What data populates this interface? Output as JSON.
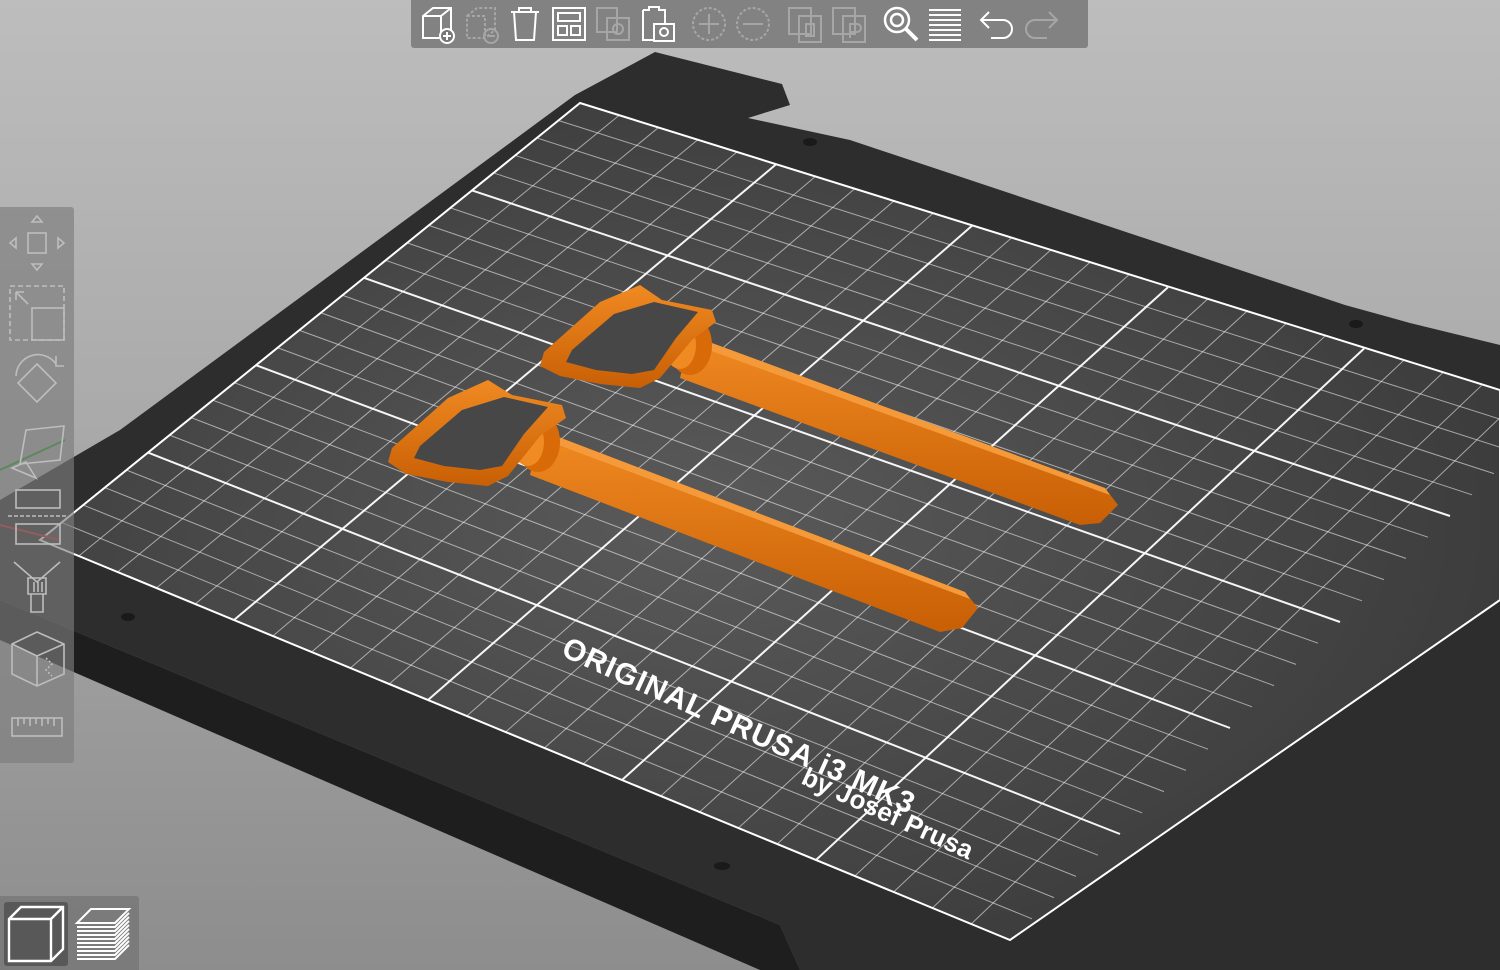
{
  "toolbar": {
    "buttons": [
      {
        "name": "add-button",
        "icon": "add-cube-icon",
        "enabled": true
      },
      {
        "name": "delete-button",
        "icon": "delete-icon",
        "enabled": false
      },
      {
        "name": "delete-all-button",
        "icon": "trash-icon",
        "enabled": true
      },
      {
        "name": "arrange-button",
        "icon": "arrange-icon",
        "enabled": true
      },
      {
        "name": "copy-button",
        "icon": "copy-icon",
        "enabled": false
      },
      {
        "name": "paste-button",
        "icon": "paste-icon",
        "enabled": true
      },
      {
        "name": "add-instance-button",
        "icon": "plus-circle-icon",
        "enabled": false
      },
      {
        "name": "remove-instance-button",
        "icon": "minus-circle-icon",
        "enabled": false
      },
      {
        "name": "split-objects-button",
        "icon": "split-objects-icon",
        "enabled": false
      },
      {
        "name": "split-parts-button",
        "icon": "split-parts-icon",
        "enabled": false
      },
      {
        "name": "search-button",
        "icon": "search-icon",
        "enabled": true
      },
      {
        "name": "layers-editing-button",
        "icon": "layers-icon",
        "enabled": true
      },
      {
        "name": "undo-button",
        "icon": "undo-icon",
        "enabled": true
      },
      {
        "name": "redo-button",
        "icon": "redo-icon",
        "enabled": false
      }
    ]
  },
  "gizmos": [
    {
      "name": "move-gizmo",
      "icon": "move-icon"
    },
    {
      "name": "scale-gizmo",
      "icon": "scale-icon"
    },
    {
      "name": "rotate-gizmo",
      "icon": "rotate-icon"
    },
    {
      "name": "place-on-face-gizmo",
      "icon": "place-on-face-icon"
    },
    {
      "name": "cut-gizmo",
      "icon": "cut-icon"
    },
    {
      "name": "paint-supports-gizmo",
      "icon": "paint-brush-icon"
    },
    {
      "name": "seam-gizmo",
      "icon": "seam-cube-icon"
    },
    {
      "name": "measure-gizmo",
      "icon": "ruler-icon"
    }
  ],
  "view_switch": {
    "active": "3d",
    "buttons": [
      {
        "name": "view-3d-button",
        "icon": "cube-3d-icon"
      },
      {
        "name": "view-preview-button",
        "icon": "layers-preview-icon"
      }
    ]
  },
  "bed": {
    "label_line1": "ORIGINAL PRUSA i3 MK3",
    "label_line2": "by Josef Prusa"
  },
  "colors": {
    "background_top": "#bdbdbd",
    "background_bottom": "#8d8d8d",
    "bed_plate": "#2e2e2e",
    "bed_grid": "#ffffff",
    "model": "#e8760c",
    "toolbar": "#787878"
  }
}
